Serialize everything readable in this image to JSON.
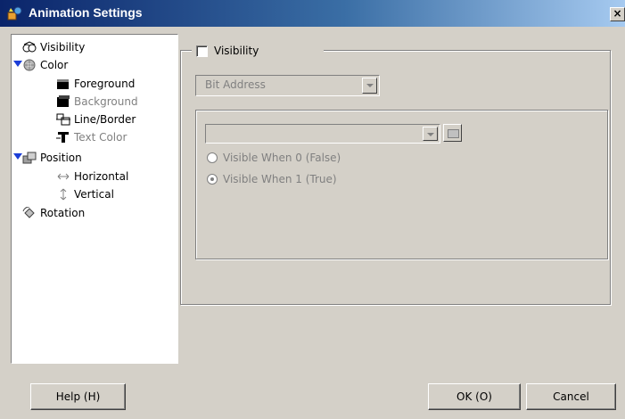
{
  "window": {
    "title": "Animation Settings",
    "close_glyph": "×",
    "icon": "animation-app-icon"
  },
  "tree": {
    "items": [
      {
        "label": "Visibility",
        "icon": "visibility-icon",
        "enabled": true
      },
      {
        "label": "Color",
        "icon": "color-icon",
        "enabled": true,
        "expanded": true
      },
      {
        "label": "Foreground",
        "icon": "foreground-icon",
        "enabled": true
      },
      {
        "label": "Background",
        "icon": "background-icon",
        "enabled": false
      },
      {
        "label": "Line/Border",
        "icon": "line-border-icon",
        "enabled": true
      },
      {
        "label": "Text Color",
        "icon": "text-color-icon",
        "enabled": false
      },
      {
        "label": "Position",
        "icon": "position-icon",
        "enabled": true,
        "expanded": true
      },
      {
        "label": "Horizontal",
        "icon": "horizontal-arrow-icon",
        "enabled": true
      },
      {
        "label": "Vertical",
        "icon": "vertical-arrow-icon",
        "enabled": true
      },
      {
        "label": "Rotation",
        "icon": "rotation-icon",
        "enabled": true
      }
    ]
  },
  "visibility_panel": {
    "checkbox_label": "Visibility",
    "checked": false,
    "address_type": "Bit Address",
    "address_value": "",
    "radio_false": "Visible When 0 (False)",
    "radio_true": "Visible When 1 (True)",
    "selected_radio": "true"
  },
  "buttons": {
    "help": "Help (H)",
    "ok": "OK (O)",
    "cancel": "Cancel"
  }
}
